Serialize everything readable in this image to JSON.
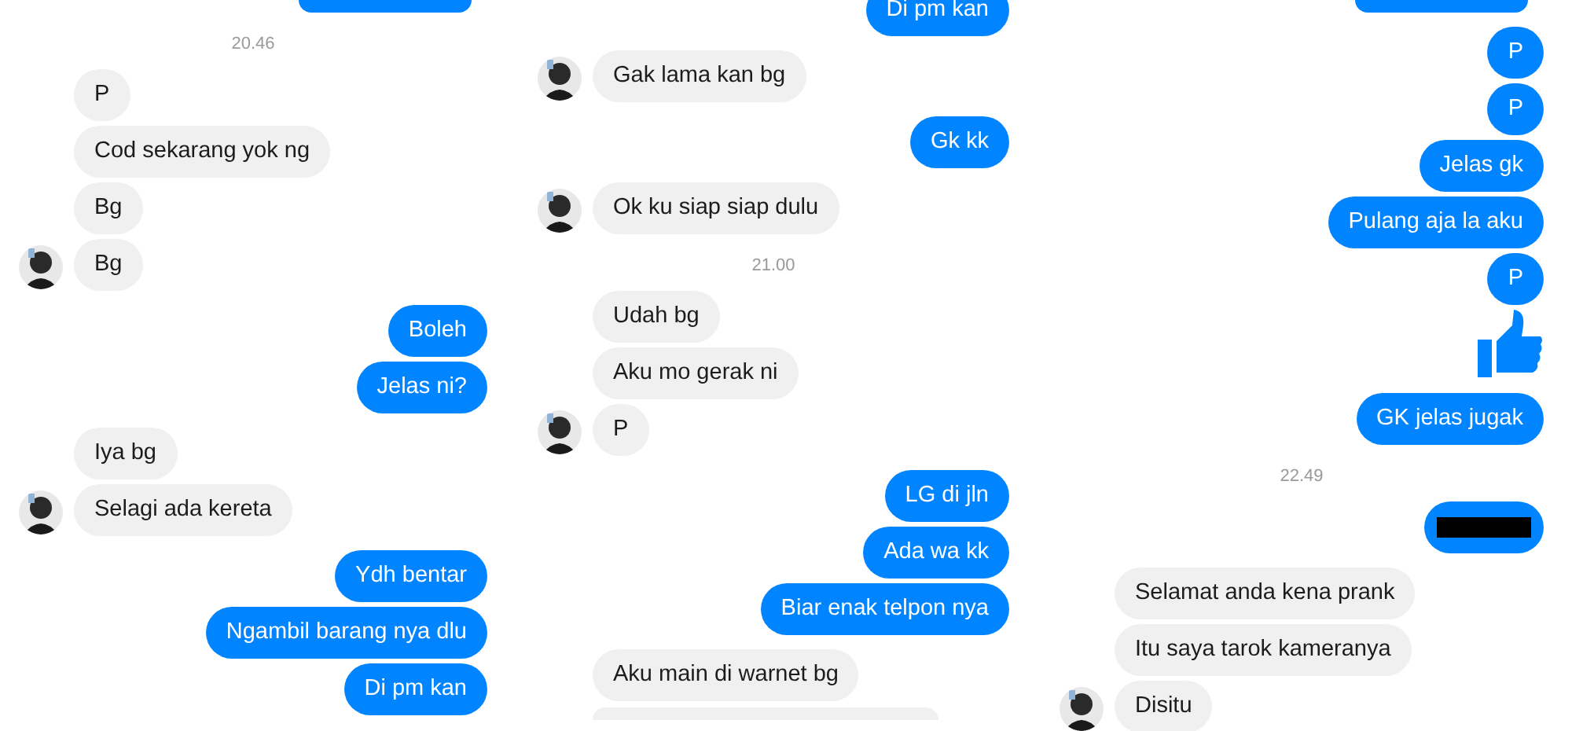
{
  "panels": [
    {
      "messages": [
        {
          "kind": "topstub"
        },
        {
          "kind": "time",
          "text": "20.46"
        },
        {
          "kind": "in",
          "text": "P",
          "avatar": false
        },
        {
          "kind": "in",
          "text": "Cod sekarang yok ng",
          "avatar": false
        },
        {
          "kind": "in",
          "text": "Bg",
          "avatar": false
        },
        {
          "kind": "in",
          "text": "Bg",
          "avatar": true
        },
        {
          "kind": "out",
          "text": "Boleh"
        },
        {
          "kind": "out",
          "text": "Jelas ni?"
        },
        {
          "kind": "in",
          "text": "Iya bg",
          "avatar": false
        },
        {
          "kind": "in",
          "text": "Selagi ada kereta",
          "avatar": true
        },
        {
          "kind": "out",
          "text": "Ydh bentar"
        },
        {
          "kind": "out",
          "text": "Ngambil barang nya dlu"
        },
        {
          "kind": "out",
          "text": "Di pm kan"
        }
      ]
    },
    {
      "messages": [
        {
          "kind": "out",
          "text": "Di pm kan",
          "cut_top": true
        },
        {
          "kind": "in",
          "text": "Gak lama kan bg",
          "avatar": true
        },
        {
          "kind": "out",
          "text": "Gk kk"
        },
        {
          "kind": "in",
          "text": "Ok ku siap siap dulu",
          "avatar": true
        },
        {
          "kind": "time",
          "text": "21.00"
        },
        {
          "kind": "in",
          "text": "Udah bg",
          "avatar": false
        },
        {
          "kind": "in",
          "text": "Aku mo gerak ni",
          "avatar": false
        },
        {
          "kind": "in",
          "text": "P",
          "avatar": true
        },
        {
          "kind": "out",
          "text": "LG di jln"
        },
        {
          "kind": "out",
          "text": "Ada wa kk"
        },
        {
          "kind": "out",
          "text": "Biar enak telpon nya"
        },
        {
          "kind": "in",
          "text": "Aku main di warnet bg",
          "avatar": false
        },
        {
          "kind": "bottomstub"
        }
      ]
    },
    {
      "messages": [
        {
          "kind": "topstub"
        },
        {
          "kind": "out",
          "text": "P"
        },
        {
          "kind": "out",
          "text": "P"
        },
        {
          "kind": "out",
          "text": "Jelas gk"
        },
        {
          "kind": "out",
          "text": "Pulang aja la aku"
        },
        {
          "kind": "out",
          "text": "P"
        },
        {
          "kind": "like"
        },
        {
          "kind": "out",
          "text": "GK jelas jugak"
        },
        {
          "kind": "time",
          "text": "22.49"
        },
        {
          "kind": "redacted"
        },
        {
          "kind": "in",
          "text": "Selamat anda kena prank",
          "avatar": false
        },
        {
          "kind": "in",
          "text": "Itu saya tarok kameranya",
          "avatar": false
        },
        {
          "kind": "in",
          "text": "Disitu",
          "avatar": true
        }
      ]
    }
  ]
}
